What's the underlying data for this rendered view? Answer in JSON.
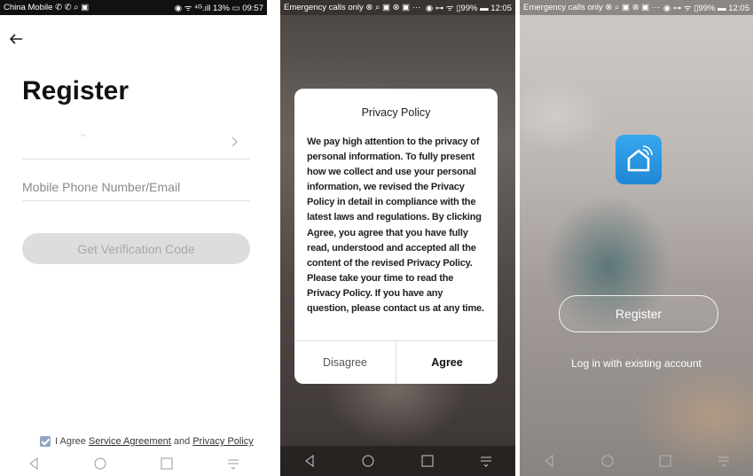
{
  "screen1": {
    "status_left": "China Mobile ✆ ✆ ⌕ ▣",
    "status_right": "◉ ᯤ ⁴ᴳ.ıll 13% ▭ 09:57",
    "title": "Register",
    "phone_placeholder": "Mobile Phone Number/Email",
    "verification_button": "Get Verification Code",
    "agree_prefix": "I Agree",
    "service_agreement": "Service Agreement",
    "agree_and": "and",
    "privacy_policy": "Privacy Policy"
  },
  "screen2": {
    "status_left": "Emergency calls only ⊗ ⌕ ▣ ⊗ ▣ ···",
    "status_right": "◉ ⊶ ᯤ ▯99% ▬ 12:05",
    "dialog_title": "Privacy Policy",
    "dialog_body": "We pay high attention to the privacy of personal information. To fully present how we collect and use your personal information, we revised the Privacy Policy in detail in compliance with the latest laws and regulations. By clicking Agree, you agree that you have fully read, understood and accepted all the content of the revised Privacy Policy. Please take your time to read the Privacy Policy. If you have any question, please contact us at any time.",
    "disagree_button": "Disagree",
    "agree_button": "Agree"
  },
  "screen3": {
    "status_left": "Emergency calls only ⊗ ⌕ ▣ ⊗ ▣ ···",
    "status_right": "◉ ⊶ ᯤ ▯99% ▬ 12:05",
    "register_button": "Register",
    "login_link": "Log in with existing account"
  },
  "icons": {
    "back": "back-arrow-icon",
    "chevron": "chevron-right-icon",
    "nav": [
      "nav-back-icon",
      "nav-home-icon",
      "nav-recents-icon",
      "nav-notification-icon"
    ],
    "logo": "smart-home-logo-icon"
  },
  "colors": {
    "logo_blue": "#2a96e2",
    "button_disabled": "#dddddd",
    "checkbox": "#8fa8c6"
  }
}
